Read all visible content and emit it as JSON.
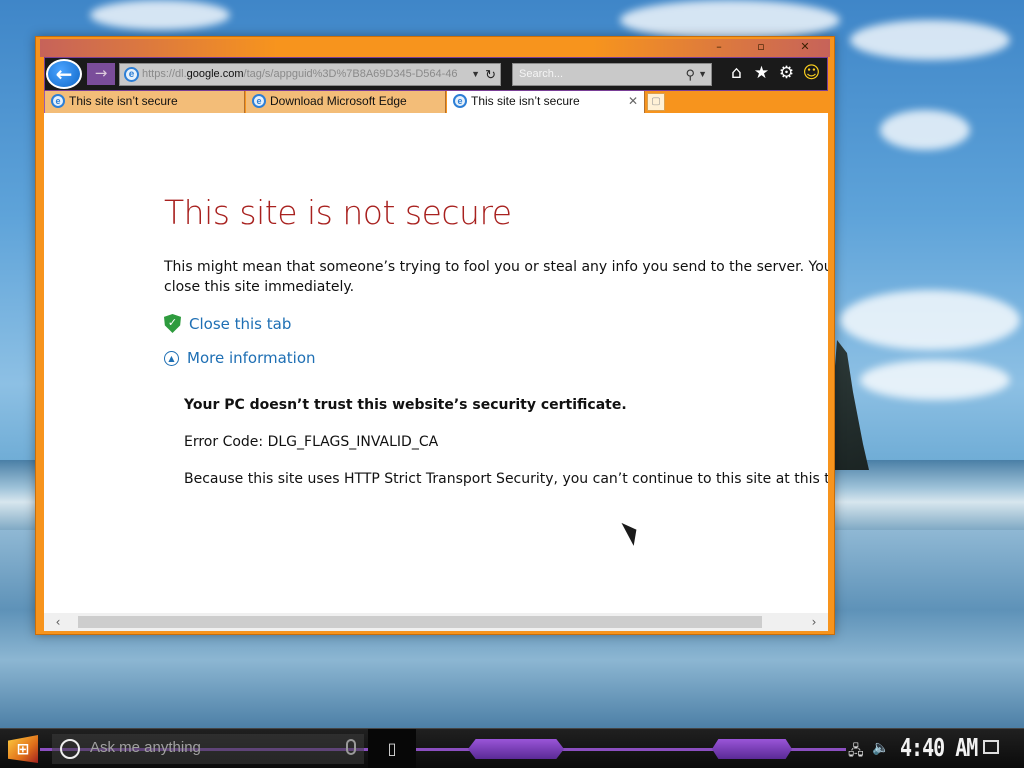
{
  "window": {
    "controls": {
      "minimize": "–",
      "maximize": "▫",
      "close": "✕"
    }
  },
  "toolbar": {
    "back_icon": "←",
    "forward_icon": "→",
    "address": {
      "prefix": "https://dl.",
      "domain": "google.com",
      "path": "/tag/s/appguid%3D%7B8A69D345-D564-46"
    },
    "search_placeholder": "Search...",
    "icons": [
      "home-icon",
      "favorites-star-icon",
      "settings-gear-icon",
      "feedback-smiley-icon"
    ]
  },
  "tabs": [
    {
      "label": "This site isn’t secure",
      "active": false
    },
    {
      "label": "Download Microsoft Edge",
      "active": false
    },
    {
      "label": "This site isn’t secure",
      "active": true
    }
  ],
  "page": {
    "title": "This site is not secure",
    "description_line1": "This might mean that someone’s trying to fool you or steal any info you send to the server. You shou",
    "description_line2": "close this site immediately.",
    "close_tab_link": "Close this tab",
    "more_info_link": "More information",
    "cert_heading": "Your PC doesn’t trust this website’s security certificate.",
    "error_code": "Error Code: DLG_FLAGS_INVALID_CA",
    "hsts_text": "Because this site uses HTTP Strict Transport Security, you can’t continue to this site at this ti"
  },
  "taskbar": {
    "search_placeholder": "Ask me anything",
    "clock": "4:40 AM"
  },
  "colors": {
    "window_frame": "#f7941d",
    "title_red": "#a8211f",
    "link_blue": "#1e6fb4",
    "accent_purple": "#8b4fc0"
  }
}
